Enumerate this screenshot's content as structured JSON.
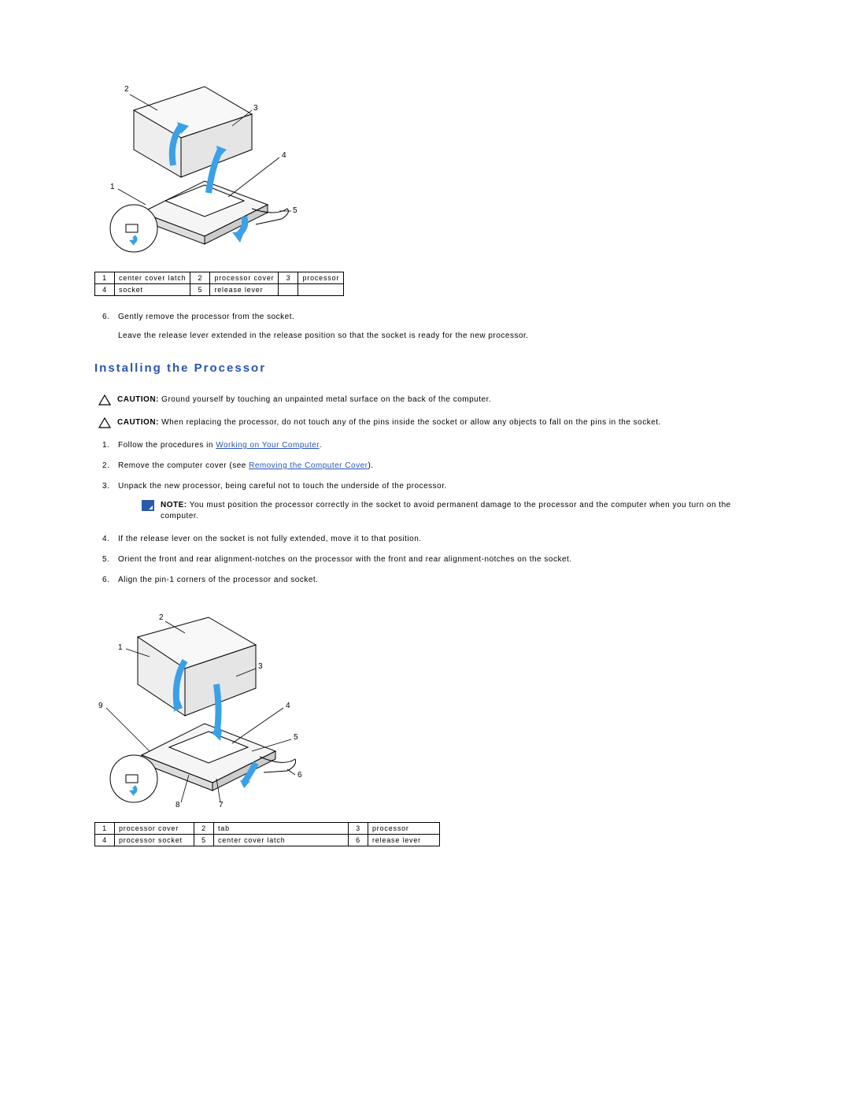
{
  "figure1": {
    "labels": {
      "l1": "1",
      "l2": "2",
      "l3": "3",
      "l4": "4",
      "l5": "5"
    },
    "table": {
      "r1c1n": "1",
      "r1c1": "center cover latch",
      "r1c2n": "2",
      "r1c2": "processor cover",
      "r1c3n": "3",
      "r1c3": "processor",
      "r2c1n": "4",
      "r2c1": "socket",
      "r2c2n": "5",
      "r2c2": "release lever",
      "r2c3n": "",
      "r2c3": ""
    }
  },
  "removal_steps": {
    "s6num": "6.",
    "s6": "Gently remove the processor from the socket.",
    "s6sub": "Leave the release lever extended in the release position so that the socket is ready for the new processor."
  },
  "section_heading": "Installing the Processor",
  "cautions": {
    "label": "CAUTION:",
    "c1": "Ground yourself by touching an unpainted metal surface on the back of the computer.",
    "c2": "When replacing the processor, do not touch any of the pins inside the socket or allow any objects to fall on the pins in the socket."
  },
  "install_steps": {
    "s1num": "1.",
    "s1a": "Follow the procedures in ",
    "s1link": "Working on Your Computer",
    "s1b": ".",
    "s2num": "2.",
    "s2a": "Remove the computer cover (see ",
    "s2link": "Removing the Computer Cover",
    "s2b": ").",
    "s3num": "3.",
    "s3": "Unpack the new processor, being careful not to touch the underside of the processor.",
    "notelabel": "NOTE:",
    "s3note": "You must position the processor correctly in the socket to avoid permanent damage to the processor and the computer when you turn on the computer.",
    "s4num": "4.",
    "s4": "If the release lever on the socket is not fully extended, move it to that position.",
    "s5num": "5.",
    "s5": "Orient the front and rear alignment-notches on the processor with the front and rear alignment-notches on the socket.",
    "s6num": "6.",
    "s6": "Align the pin-1 corners of the processor and socket."
  },
  "figure2": {
    "labels": {
      "l1": "1",
      "l2": "2",
      "l3": "3",
      "l4": "4",
      "l5": "5",
      "l6": "6",
      "l7": "7",
      "l8": "8",
      "l9": "9"
    },
    "table": {
      "r1c1n": "1",
      "r1c1": "processor cover",
      "r1c2n": "2",
      "r1c2": "tab",
      "r1c3n": "3",
      "r1c3": "processor",
      "r2c1n": "4",
      "r2c1": "processor socket",
      "r2c2n": "5",
      "r2c2": "center cover latch",
      "r2c3n": "6",
      "r2c3": "release lever"
    }
  }
}
